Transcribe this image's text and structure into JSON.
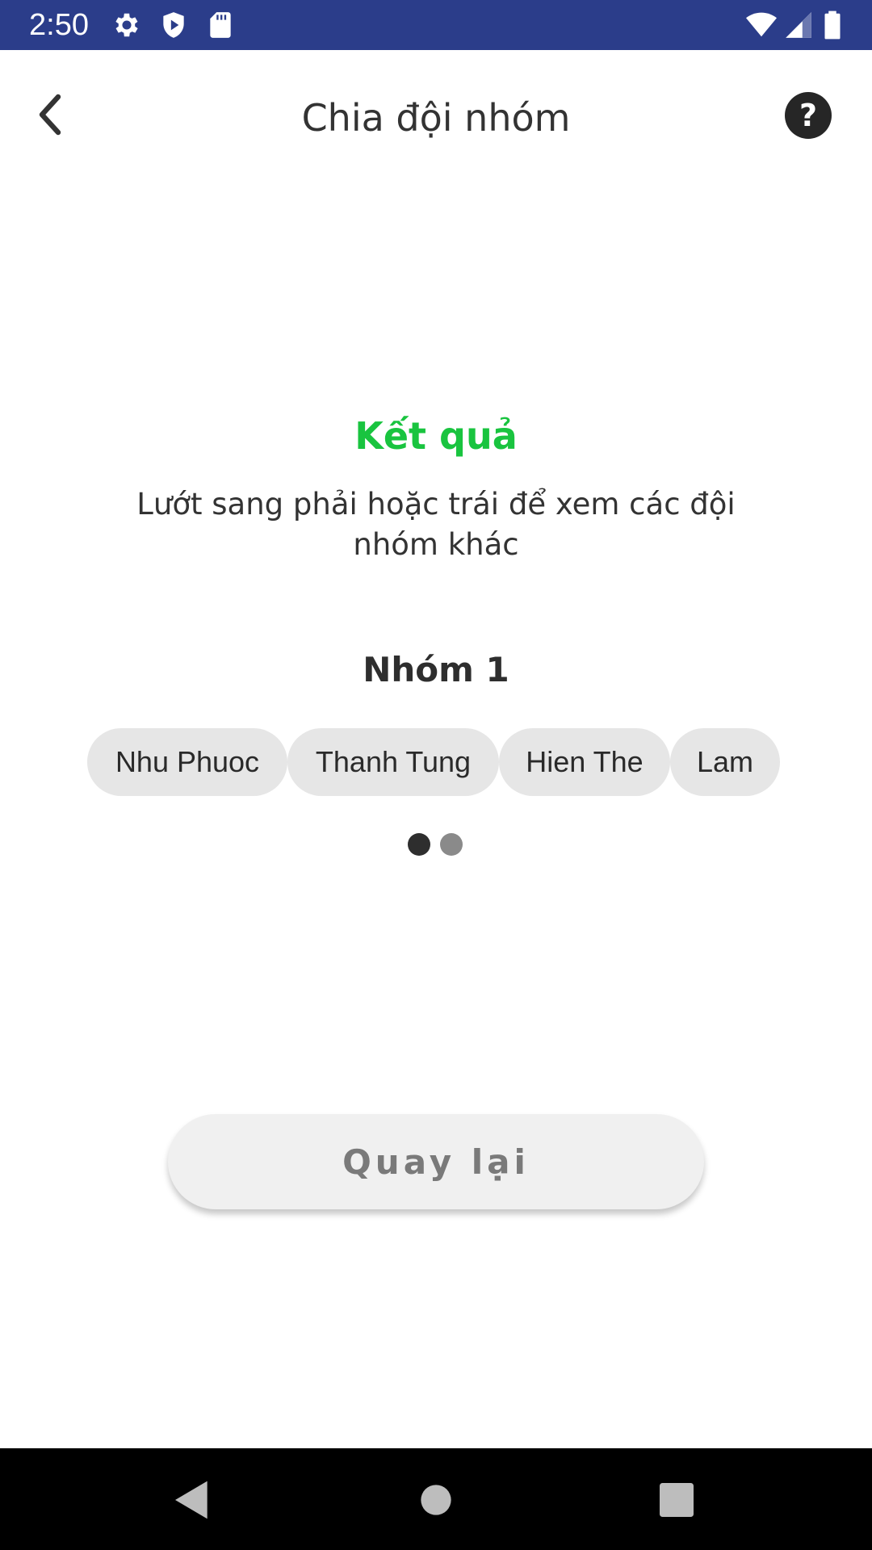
{
  "status_bar": {
    "time": "2:50",
    "icons": [
      "settings-icon",
      "shield-play-icon",
      "sd-card-icon",
      "wifi-icon",
      "signal-icon",
      "battery-icon"
    ],
    "background": "#2b3d8a"
  },
  "header": {
    "title": "Chia đội nhóm",
    "help_label": "?",
    "back_icon": "chevron-left-icon"
  },
  "result": {
    "title": "Kết quả",
    "subtitle": "Lướt sang phải hoặc trái để xem các đội nhóm khác",
    "title_color": "#19c43f"
  },
  "group": {
    "title": "Nhóm 1",
    "members": [
      "Nhu Phuoc",
      "Thanh Tung",
      "Hien The",
      "Lam"
    ]
  },
  "pager": {
    "current": 1,
    "total": 2
  },
  "actions": {
    "back_label": "Quay lại"
  },
  "nav_bar": {
    "buttons": [
      "back-triangle-icon",
      "home-circle-icon",
      "recents-square-icon"
    ]
  }
}
